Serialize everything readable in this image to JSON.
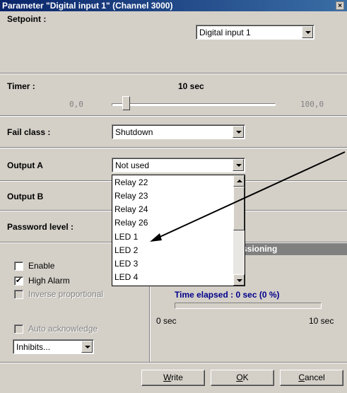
{
  "window": {
    "title": "Parameter \"Digital input 1\" (Channel 3000)",
    "close_glyph": "×"
  },
  "setpoint": {
    "label": "Setpoint :",
    "value": "Digital input 1"
  },
  "timer": {
    "label": "Timer :",
    "value_text": "10 sec",
    "min": "0,0",
    "max": "100,0",
    "fraction": 0.1
  },
  "fail_class": {
    "label": "Fail class :",
    "value": "Shutdown"
  },
  "output_a": {
    "label": "Output A",
    "value": "Not used",
    "options": [
      "Relay 22",
      "Relay 23",
      "Relay 24",
      "Relay 26",
      "LED 1",
      "LED 2",
      "LED 3",
      "LED 4"
    ]
  },
  "output_b": {
    "label": "Output B"
  },
  "password_level": {
    "label": "Password level :"
  },
  "checkboxes": {
    "enable": {
      "label": "Enable",
      "checked": false,
      "enabled": true
    },
    "high_alarm": {
      "label": "High Alarm",
      "checked": true,
      "enabled": true
    },
    "inverse": {
      "label": "Inverse proportional",
      "checked": false,
      "enabled": false
    },
    "auto_ack": {
      "label": "Auto acknowledge",
      "checked": false,
      "enabled": false
    }
  },
  "inhibits": {
    "value": "Inhibits..."
  },
  "commissioning": {
    "header_visible": "ssioning",
    "time_elapsed": "Time elapsed : 0 sec (0 %)",
    "progress_fraction": 0.0,
    "start": "0 sec",
    "end": "10 sec"
  },
  "buttons": {
    "write_key": "W",
    "write_rest": "rite",
    "ok_key": "O",
    "ok_rest": "K",
    "cancel_key": "C",
    "cancel_rest": "ancel"
  },
  "colors": {
    "title_start": "#0a246a",
    "title_end": "#3a6ea5",
    "dialog_bg": "#d4d0c8",
    "link_blue": "#00008b"
  }
}
